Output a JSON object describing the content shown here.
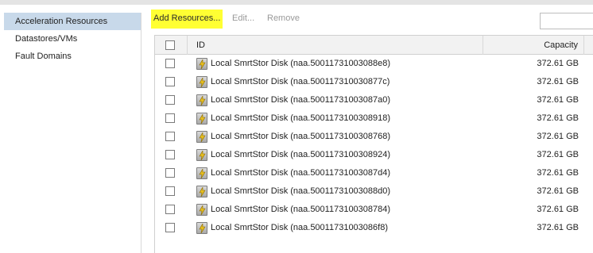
{
  "sidebar": {
    "items": [
      {
        "label": "Acceleration Resources",
        "selected": true
      },
      {
        "label": "Datastores/VMs",
        "selected": false
      },
      {
        "label": "Fault Domains",
        "selected": false
      }
    ]
  },
  "toolbar": {
    "add_label": "Add Resources...",
    "edit_label": "Edit...",
    "remove_label": "Remove",
    "highlight_color": "#ffff33"
  },
  "grid": {
    "columns": {
      "id": "ID",
      "capacity": "Capacity"
    },
    "rows": [
      {
        "id": "Local SmrtStor Disk (naa.50011731003088e8)",
        "capacity": "372.61 GB"
      },
      {
        "id": "Local SmrtStor Disk (naa.500117310030877c)",
        "capacity": "372.61 GB"
      },
      {
        "id": "Local SmrtStor Disk (naa.50011731003087a0)",
        "capacity": "372.61 GB"
      },
      {
        "id": "Local SmrtStor Disk (naa.5001173100308918)",
        "capacity": "372.61 GB"
      },
      {
        "id": "Local SmrtStor Disk (naa.5001173100308768)",
        "capacity": "372.61 GB"
      },
      {
        "id": "Local SmrtStor Disk (naa.5001173100308924)",
        "capacity": "372.61 GB"
      },
      {
        "id": "Local SmrtStor Disk (naa.50011731003087d4)",
        "capacity": "372.61 GB"
      },
      {
        "id": "Local SmrtStor Disk (naa.50011731003088d0)",
        "capacity": "372.61 GB"
      },
      {
        "id": "Local SmrtStor Disk (naa.5001173100308784)",
        "capacity": "372.61 GB"
      },
      {
        "id": "Local SmrtStor Disk (naa.50011731003086f8)",
        "capacity": "372.61 GB"
      }
    ],
    "row_icon": "disk-flash-icon"
  }
}
